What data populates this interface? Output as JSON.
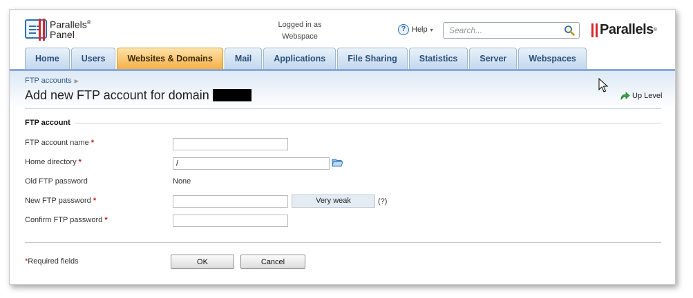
{
  "header": {
    "logo_line1": "Parallels",
    "logo_reg": "®",
    "logo_line2": "Panel",
    "logged_in_label": "Logged in as",
    "logged_in_user": "Webspace",
    "help_label": "Help",
    "help_arrow": "▾",
    "search_placeholder": "Search...",
    "brand_name": "Parallels",
    "brand_reg": "®"
  },
  "tabs": [
    {
      "label": "Home",
      "active": false
    },
    {
      "label": "Users",
      "active": false
    },
    {
      "label": "Websites & Domains",
      "active": true
    },
    {
      "label": "Mail",
      "active": false
    },
    {
      "label": "Applications",
      "active": false
    },
    {
      "label": "File Sharing",
      "active": false
    },
    {
      "label": "Statistics",
      "active": false
    },
    {
      "label": "Server",
      "active": false
    },
    {
      "label": "Webspaces",
      "active": false
    }
  ],
  "page": {
    "breadcrumb": "FTP accounts",
    "title": "Add new FTP account for domain",
    "up_level": "Up Level"
  },
  "form": {
    "section_title": "FTP account",
    "required_mark": "*",
    "fields": {
      "name_label": "FTP account name",
      "name_value": "",
      "home_label": "Home directory",
      "home_value": "/",
      "old_pw_label": "Old FTP password",
      "old_pw_value": "None",
      "new_pw_label": "New FTP password",
      "new_pw_value": "",
      "strength": "Very weak",
      "strength_help": "(?)",
      "confirm_label": "Confirm FTP password",
      "confirm_value": ""
    },
    "required_note": "Required fields",
    "ok_label": "OK",
    "cancel_label": "Cancel"
  },
  "colors": {
    "active_tab": "#f6b046",
    "tab": "#c3d8ee",
    "accent_blue": "#2d6db5",
    "required_red": "#c41818",
    "brand_red": "#d9242b"
  },
  "icons": [
    "panel-logo-icon",
    "help-icon",
    "search-icon",
    "up-level-icon",
    "folder-icon",
    "mouse-cursor-icon"
  ]
}
